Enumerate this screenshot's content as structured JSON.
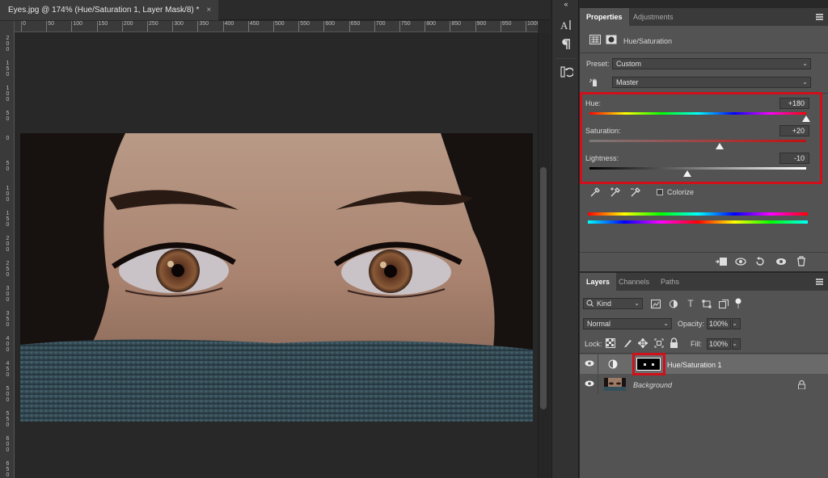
{
  "document": {
    "tab_title": "Eyes.jpg @ 174% (Hue/Saturation 1, Layer Mask/8) *",
    "close_icon": "×"
  },
  "ruler": {
    "top_labels": [
      "0",
      "50",
      "100",
      "150",
      "200",
      "250",
      "300",
      "350",
      "400",
      "450",
      "500",
      "550",
      "600",
      "650",
      "700",
      "750",
      "800",
      "850",
      "900",
      "950",
      "1000"
    ],
    "left_labels": [
      "2 0 0",
      "1 5 0",
      "1 0 0",
      "5 0",
      "0",
      "5 0",
      "1 0 0",
      "1 5 0",
      "2 0 0",
      "2 5 0",
      "3 0 0",
      "3 5 0",
      "4 0 0",
      "4 5 0",
      "5 0 0",
      "5 5 0",
      "6 0 0",
      "6 5 0"
    ]
  },
  "dock": {
    "collapse_icon": "«",
    "icons": [
      "character-icon",
      "paragraph-icon",
      "history-icon"
    ]
  },
  "properties": {
    "tabs": [
      {
        "label": "Properties",
        "active": true
      },
      {
        "label": "Adjustments",
        "active": false
      }
    ],
    "adjustment_title": "Hue/Saturation",
    "preset_label": "Preset:",
    "preset_value": "Custom",
    "channel_value": "Master",
    "hue": {
      "label": "Hue:",
      "value": "+180",
      "level": 1.0
    },
    "saturation": {
      "label": "Saturation:",
      "value": "+20",
      "level": 0.6
    },
    "lightness": {
      "label": "Lightness:",
      "value": "-10",
      "level": 0.45
    },
    "colorize_label": "Colorize",
    "colorize_checked": false,
    "highlight_color": "#d0101a"
  },
  "layers": {
    "tabs": [
      {
        "label": "Layers",
        "active": true
      },
      {
        "label": "Channels",
        "active": false
      },
      {
        "label": "Paths",
        "active": false
      }
    ],
    "filter_kind": "Kind",
    "blend_mode": "Normal",
    "opacity_label": "Opacity:",
    "opacity_value": "100%",
    "lock_label": "Lock:",
    "fill_label": "Fill:",
    "fill_value": "100%",
    "rows": [
      {
        "name": "Hue/Saturation 1",
        "selected": true
      },
      {
        "name": "Background",
        "selected": false,
        "italic": true
      }
    ]
  }
}
